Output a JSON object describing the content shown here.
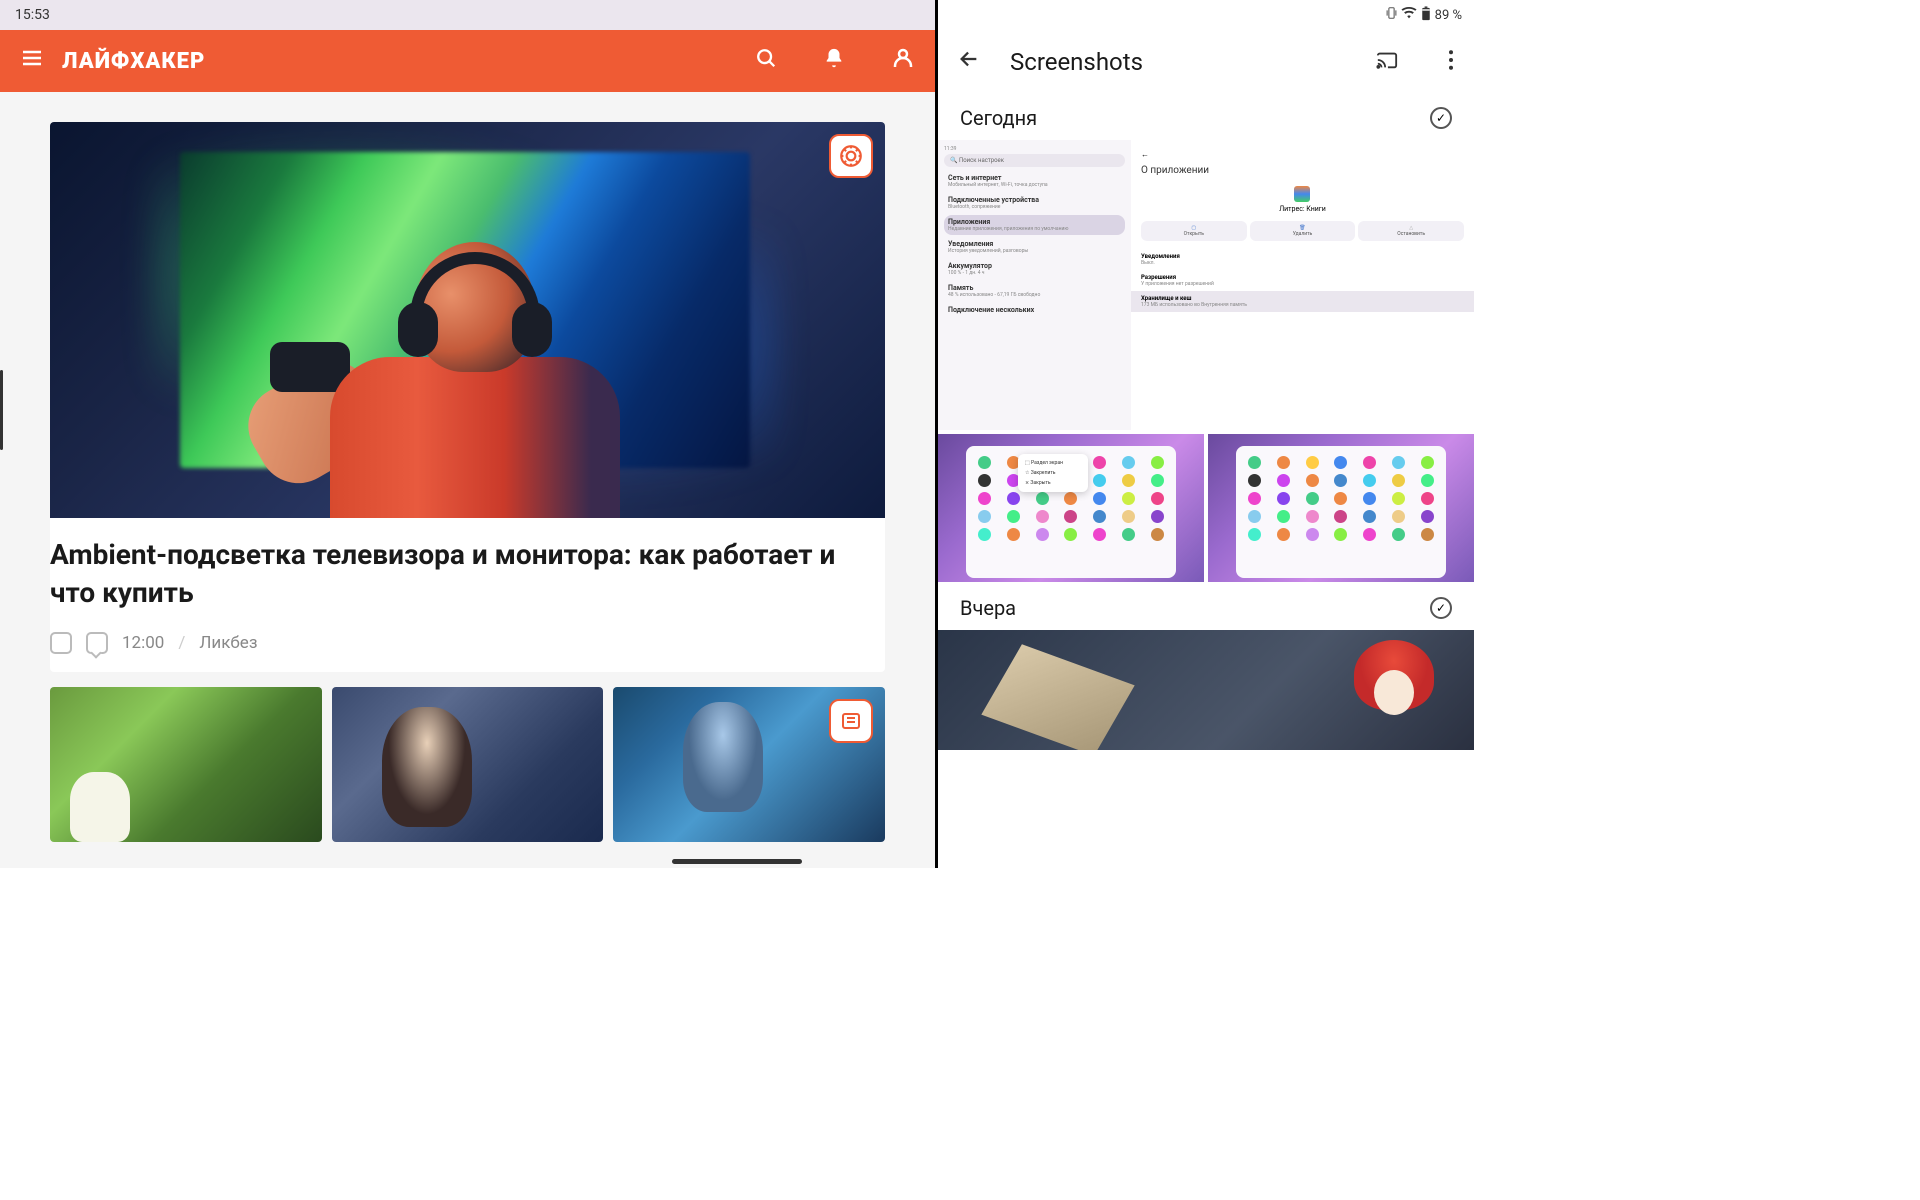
{
  "status": {
    "time": "15:53",
    "battery": "89 %"
  },
  "left": {
    "logo": "ЛАЙФХАКЕР",
    "article": {
      "title": "Ambient-подсветка телевизора и монитора: как работает и что купить",
      "time": "12:00",
      "category": "Ликбез"
    }
  },
  "right": {
    "title": "Screenshots",
    "today": "Сегодня",
    "yesterday": "Вчера",
    "mock": {
      "search": "Поиск настроек",
      "net": "Сеть и интернет",
      "net_sub": "Мобильный интернет, Wi-Fi, точка доступа",
      "devices": "Подключенные устройства",
      "devices_sub": "Bluetooth, сопряжение",
      "apps": "Приложения",
      "apps_sub": "Недавние приложения, приложения по умолчанию",
      "notif": "Уведомления",
      "notif_sub": "История уведомлений, разговоры",
      "battery": "Аккумулятор",
      "battery_sub": "100 % - 1 дн. 4 ч",
      "storage": "Память",
      "storage_sub": "48 % использовано - 67,19 ГБ свободно",
      "connect": "Подключение нескольких",
      "about": "О приложении",
      "app_name": "Литрес: Книги",
      "open": "Открыть",
      "delete": "Удалить",
      "stop": "Остановить",
      "notif2": "Уведомления",
      "notif2_sub": "Выкл.",
      "perms": "Разрешения",
      "perms_sub": "У приложения нет разрешений",
      "store": "Хранилище и кеш",
      "store_sub": "173 МБ использовано во Внутренняя память"
    }
  }
}
